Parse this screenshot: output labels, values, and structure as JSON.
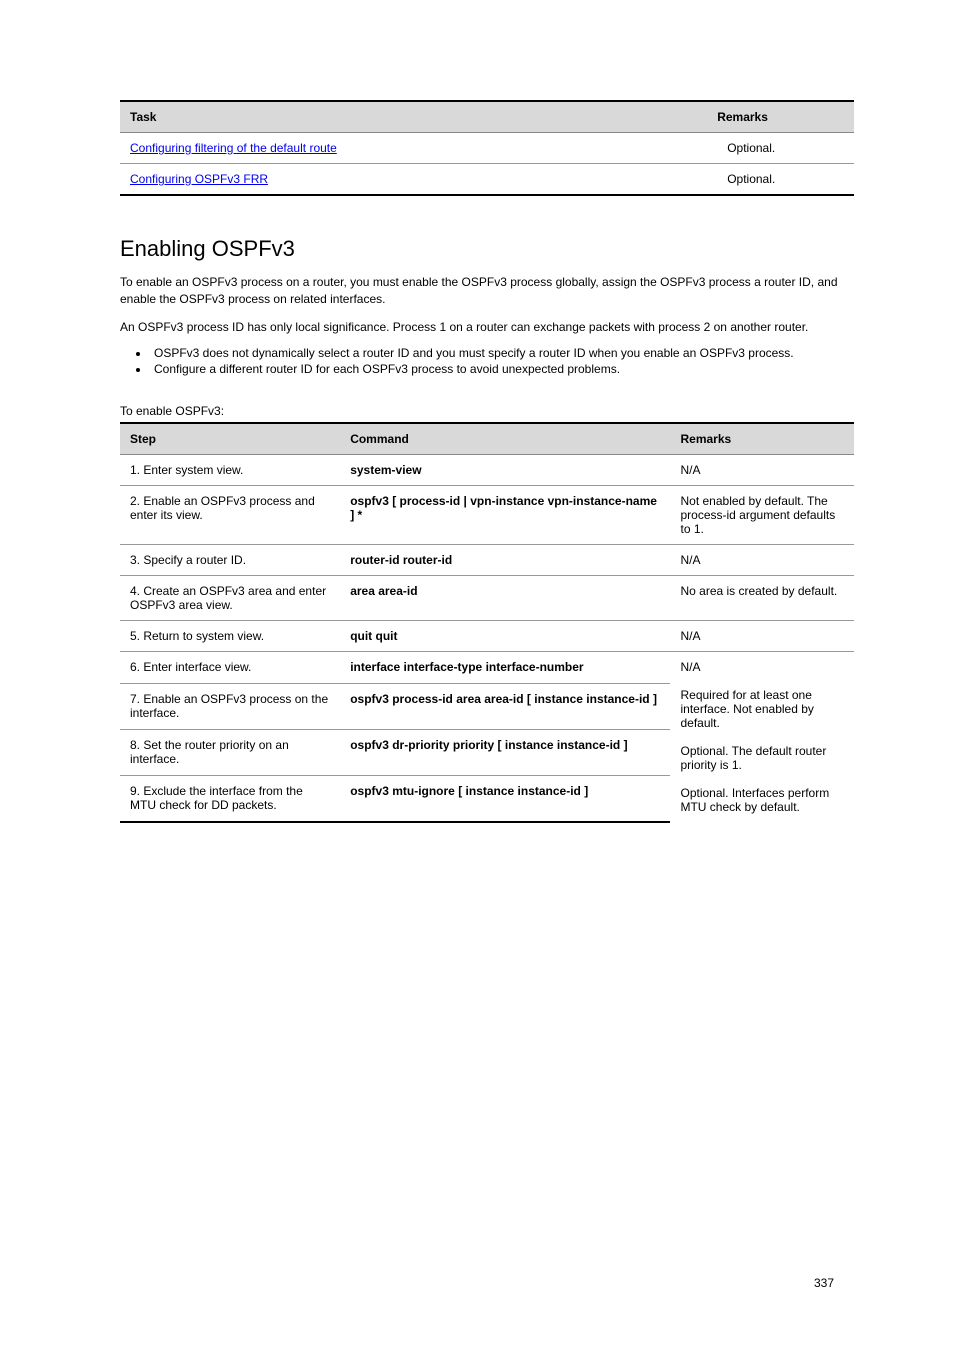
{
  "table1": {
    "headers": {
      "task": "Task",
      "remarks": "Remarks"
    },
    "rows": [
      {
        "href": "#",
        "text": "Configuring filtering of the default route",
        "remarks": "Optional."
      },
      {
        "href": "#",
        "text": "Configuring OSPFv3 FRR",
        "remarks": "Optional."
      }
    ]
  },
  "section_heading": "Enabling OSPFv3",
  "intro_text": "To enable an OSPFv3 process on a router, you must enable the OSPFv3 process globally, assign the OSPFv3 process a router ID, and enable the OSPFv3 process on related interfaces.",
  "note_intro": "An OSPFv3 process ID has only local significance. Process 1 on a router can exchange packets with process 2 on another router.",
  "note_items": [
    "OSPFv3 does not dynamically select a router ID and you must specify a router ID when you enable an OSPFv3 process.",
    "Configure a different router ID for each OSPFv3 process to avoid unexpected problems."
  ],
  "enable_text": "To enable OSPFv3:",
  "table2": {
    "headers": {
      "step": "Step",
      "command": "Command",
      "remarks": "Remarks"
    },
    "rows": [
      {
        "step": "1.  Enter system view.",
        "command": "system-view",
        "remarks": "N/A",
        "rowspan": 1
      },
      {
        "step": "2.  Enable an OSPFv3 process and enter its view.",
        "command": "ospfv3 [ process-id | vpn-instance vpn-instance-name ] *",
        "remarks": "Not enabled by default. The process-id argument defaults to 1.",
        "rowspan": 1
      },
      {
        "step": "3.  Specify a router ID.",
        "command": "router-id router-id",
        "remarks": "N/A",
        "rowspan": 1
      },
      {
        "step": "4.  Create an OSPFv3 area and enter OSPFv3 area view.",
        "command": "area area-id",
        "remarks": "No area is created by default.",
        "rowspan": 1
      },
      {
        "step": "5.  Return to system view.",
        "command": "quit\nquit",
        "remarks": "N/A",
        "rowspan": 1
      },
      {
        "step": "6.  Enter interface view.",
        "command": "interface interface-type interface-number",
        "remarks": "N/A",
        "rowspan": 1,
        "remarks_rowspan_marker": "group"
      },
      {
        "step": "7.  Enable an OSPFv3 process on the interface.",
        "command": "ospfv3 process-id area area-id [ instance instance-id ]",
        "remarks": "Required for at least one interface.\nNot enabled by default.",
        "rowspan": 1
      },
      {
        "step": "8.  Set the router priority on an interface.",
        "command": "ospfv3 dr-priority priority [ instance instance-id ]",
        "remarks": "Optional.\nThe default router priority is 1.",
        "rowspan": 1
      },
      {
        "step": "9.  Exclude the interface from the MTU check for DD packets.",
        "command": "ospfv3 mtu-ignore [ instance instance-id ]",
        "remarks": "Optional.\nInterfaces perform MTU check by default.",
        "rowspan": 1
      }
    ]
  },
  "footer": {
    "page_number": "337"
  }
}
